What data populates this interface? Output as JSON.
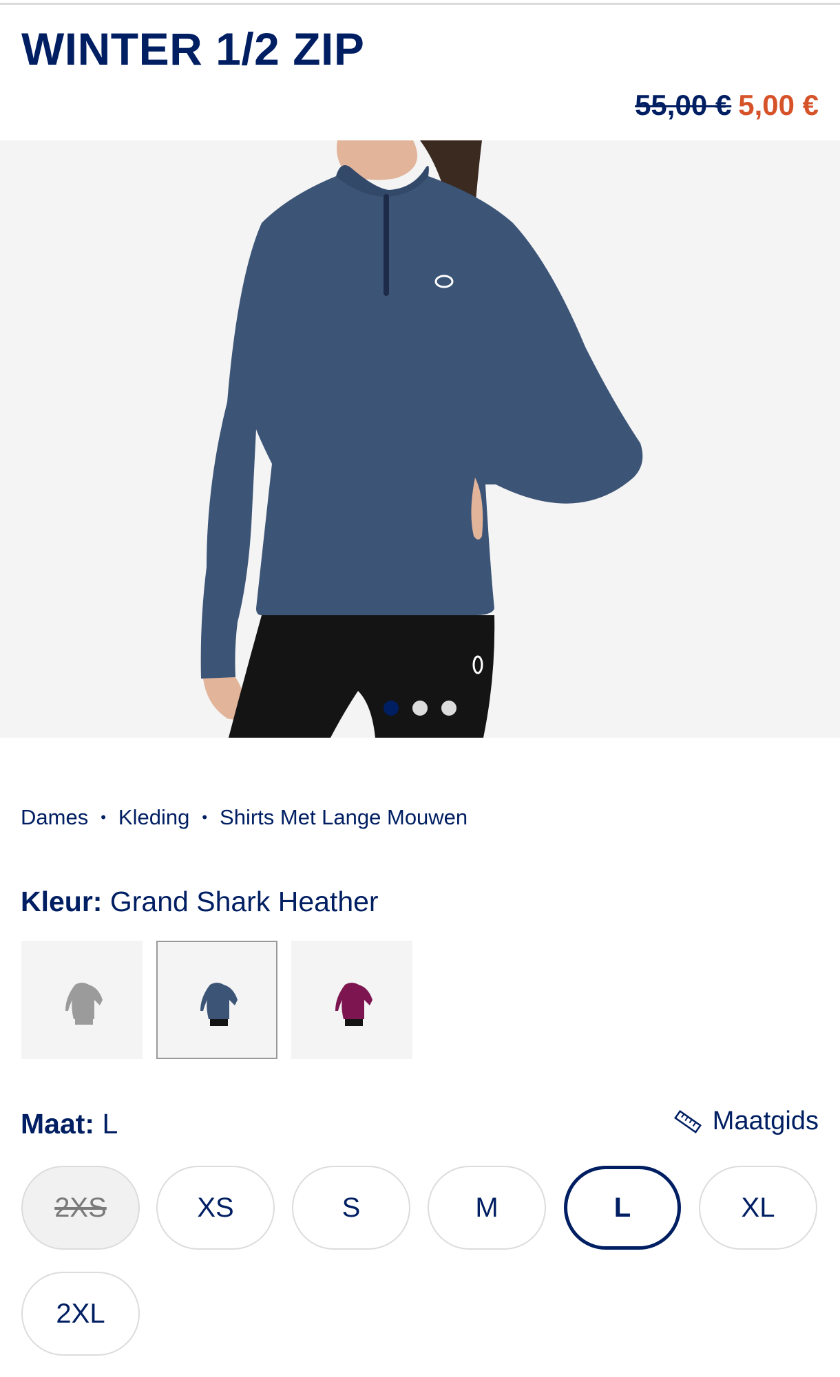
{
  "product": {
    "title": "WINTER 1/2 ZIP",
    "price_original": "55,00 €",
    "price_sale": "5,00 €"
  },
  "gallery": {
    "slide_count": 3,
    "active_slide": 1
  },
  "breadcrumb": [
    "Dames",
    "Kleding",
    "Shirts Met Lange Mouwen"
  ],
  "color": {
    "label": "Kleur:",
    "value": "Grand Shark Heather",
    "swatches": [
      {
        "color": "#9b9b9b",
        "selected": false
      },
      {
        "color": "#3c5476",
        "selected": true
      },
      {
        "color": "#7d1650",
        "selected": false
      }
    ]
  },
  "size": {
    "label": "Maat:",
    "value": "L",
    "guide_label": "Maatgids",
    "options": [
      {
        "label": "2XS",
        "available": false,
        "selected": false
      },
      {
        "label": "XS",
        "available": true,
        "selected": false
      },
      {
        "label": "S",
        "available": true,
        "selected": false
      },
      {
        "label": "M",
        "available": true,
        "selected": false
      },
      {
        "label": "L",
        "available": true,
        "selected": true
      },
      {
        "label": "XL",
        "available": true,
        "selected": false
      },
      {
        "label": "2XL",
        "available": true,
        "selected": false
      }
    ]
  },
  "colors": {
    "brand": "#001e62",
    "sale": "#d6532a",
    "jacket": "#3c5476",
    "background": "#f4f4f4"
  }
}
